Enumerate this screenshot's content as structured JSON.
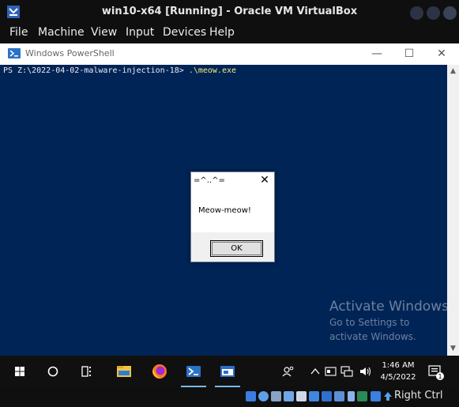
{
  "vbox": {
    "title": "win10-x64 [Running] - Oracle VM VirtualBox",
    "menu": [
      "File",
      "Machine",
      "View",
      "Input",
      "Devices",
      "Help"
    ],
    "host_key_label": "Right Ctrl"
  },
  "powershell": {
    "title": "Windows PowerShell",
    "prompt": "PS Z:\\2022-04-02-malware-injection-18> ",
    "command": ".\\meow.exe",
    "background_color": "#012456"
  },
  "msgbox": {
    "title": "=^..^=",
    "text": "Meow-meow!",
    "ok_label": "OK"
  },
  "watermark": {
    "title": "Activate Windows",
    "line1": "Go to Settings to",
    "line2": "activate Windows."
  },
  "taskbar": {
    "items": [
      "windows-start-icon",
      "search-circle-icon",
      "task-view-icon",
      "file-explorer-icon",
      "firefox-icon",
      "powershell-icon",
      "window-app-icon"
    ],
    "tray": {
      "time": "1:46 AM",
      "date": "4/5/2022",
      "notification_count": "1"
    }
  },
  "colors": {
    "accent": "#76b9ed",
    "titlebar": "#0f0f0f",
    "taskbar": "#101010"
  }
}
